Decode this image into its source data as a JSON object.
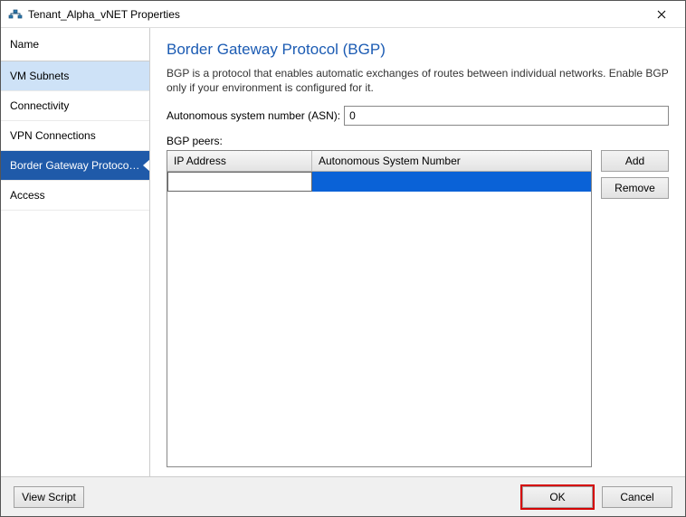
{
  "titlebar": {
    "title": "Tenant_Alpha_vNET Properties"
  },
  "sidebar": {
    "header": "Name",
    "items": [
      {
        "label": "VM Subnets",
        "state": "highlight"
      },
      {
        "label": "Connectivity",
        "state": ""
      },
      {
        "label": "VPN Connections",
        "state": ""
      },
      {
        "label": "Border Gateway Protocol...",
        "state": "selected"
      },
      {
        "label": "Access",
        "state": ""
      }
    ]
  },
  "content": {
    "heading": "Border Gateway Protocol (BGP)",
    "description": "BGP is a protocol that enables automatic exchanges of routes between individual networks. Enable BGP only if your environment is configured for it.",
    "asn_label": "Autonomous system number (ASN):",
    "asn_value": "0",
    "peers_label": "BGP peers:",
    "columns": {
      "ip": "IP Address",
      "asn": "Autonomous System Number"
    },
    "row": {
      "ip_value": "",
      "asn_value": ""
    },
    "buttons": {
      "add": "Add",
      "remove": "Remove"
    }
  },
  "footer": {
    "view_script": "View Script",
    "ok": "OK",
    "cancel": "Cancel"
  }
}
